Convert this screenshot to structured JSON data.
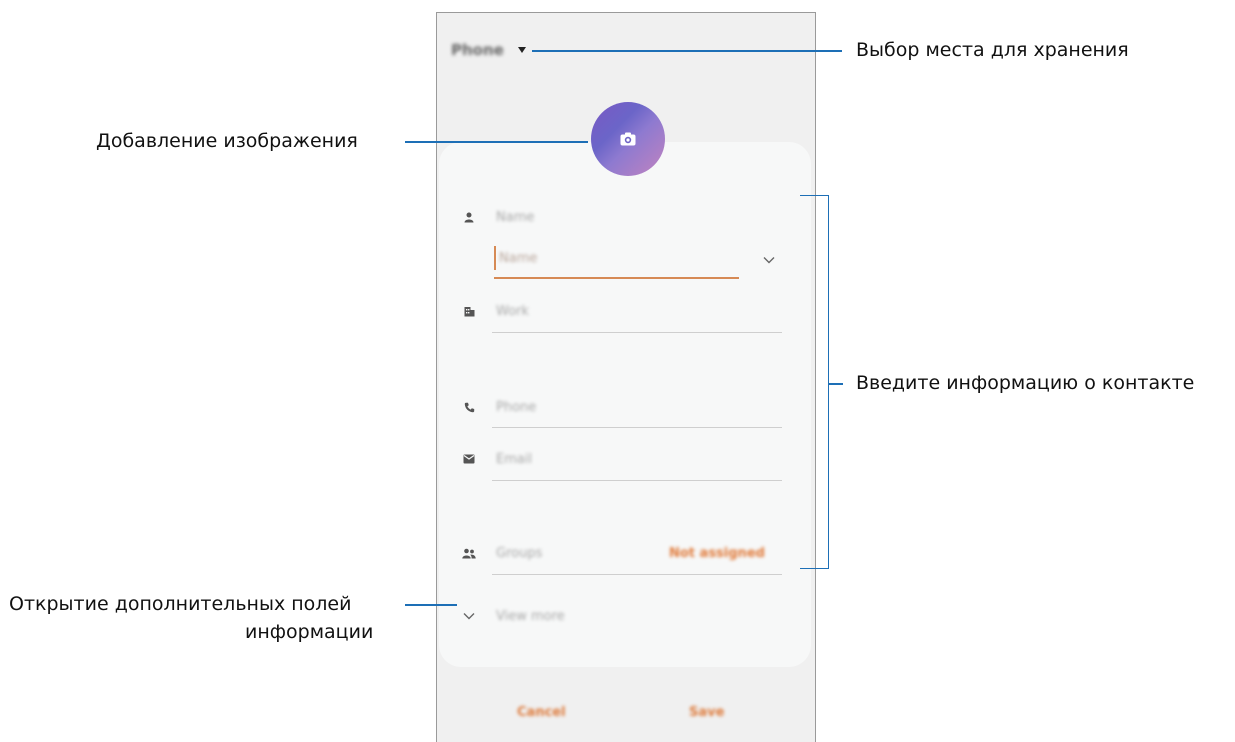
{
  "phone": {
    "storage_label": "Phone",
    "fields": {
      "name_label": "Name",
      "name_value": "Name",
      "work_label": "Work",
      "phone_label": "Phone",
      "email_label": "Email",
      "groups_label": "Groups",
      "groups_value": "Not assigned",
      "view_more": "View more"
    },
    "buttons": {
      "cancel": "Cancel",
      "save": "Save"
    },
    "icons": {
      "camera": "camera-icon",
      "person": "person-icon",
      "work": "building-icon",
      "phone": "phone-icon",
      "email": "email-icon",
      "groups": "groups-icon",
      "chevron": "chevron-down-icon"
    },
    "colors": {
      "accent": "#dd7a3b",
      "callout_line": "#1d6fb6"
    }
  },
  "callouts": {
    "storage": "Выбор места для хранения",
    "image": "Добавление изображения",
    "info": "Введите информацию о контакте",
    "more_line1": "Открытие дополнительных полей",
    "more_line2": "информации"
  }
}
